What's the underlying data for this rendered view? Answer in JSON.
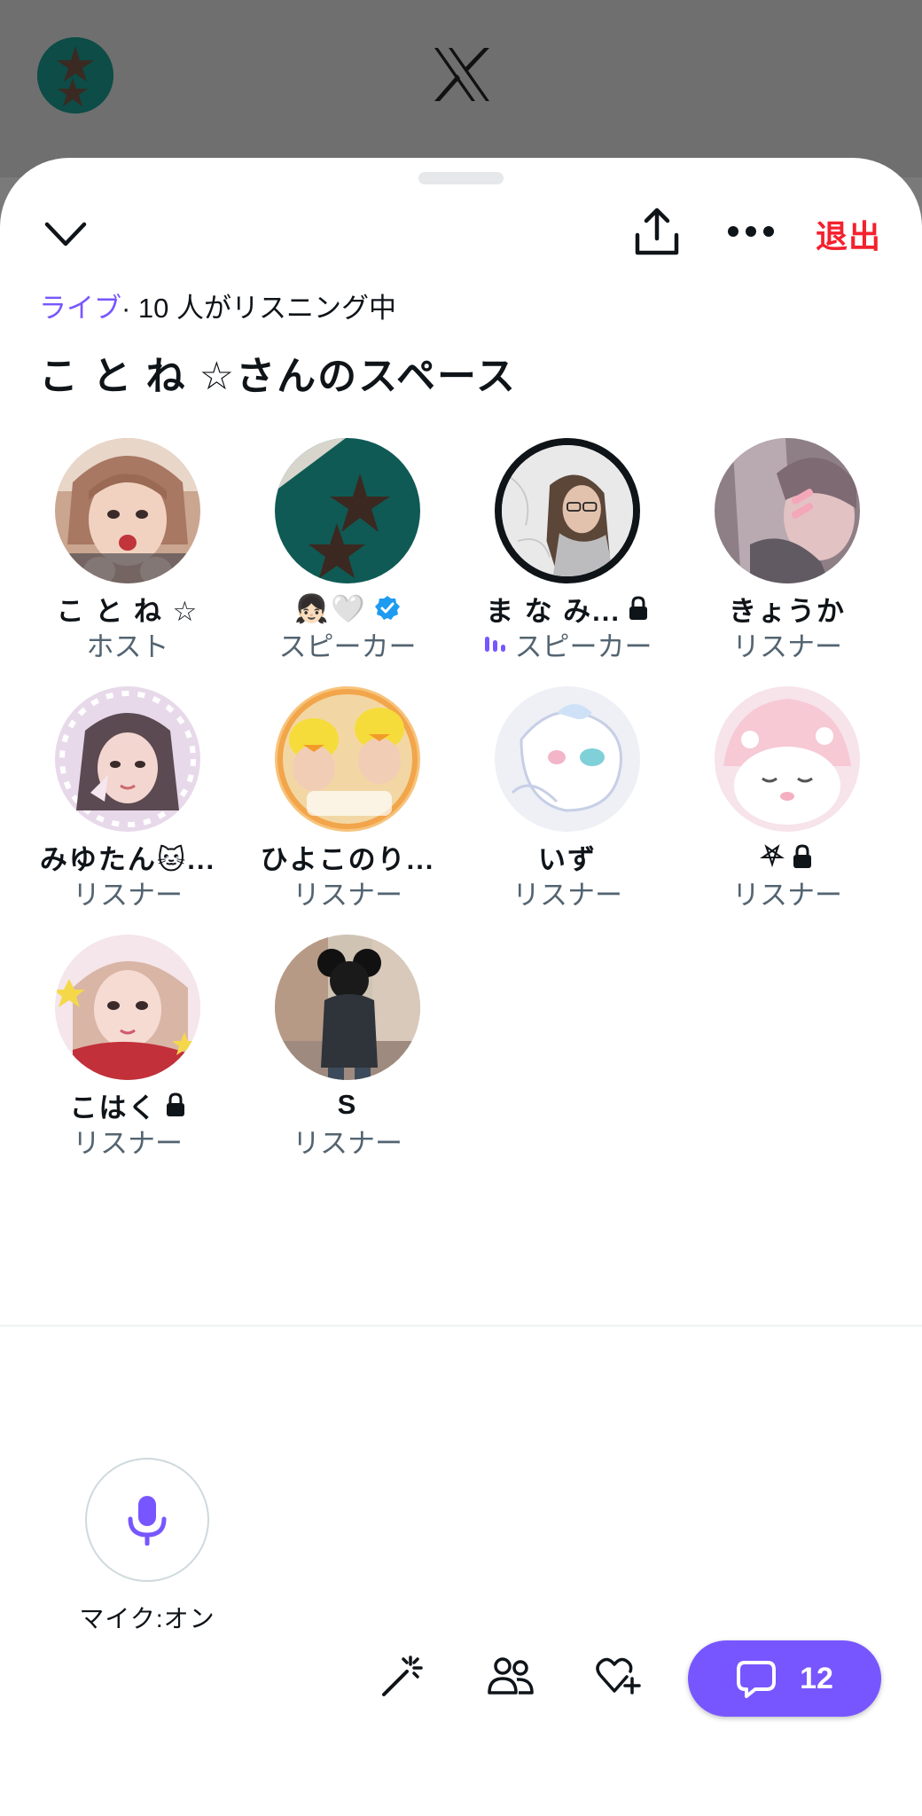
{
  "header": {
    "leave_label": "退出"
  },
  "space": {
    "live_label": "ライブ",
    "listening_text": "· 10 人がリスニング中",
    "title": "こ と ね ☆さんのスペース"
  },
  "participants": [
    {
      "name": "こ と ね ☆",
      "role": "ホスト"
    },
    {
      "name": "👧🏻🤍",
      "role": "スピーカー",
      "verified": true
    },
    {
      "name": "ま な み...",
      "role": "スピーカー",
      "locked": true,
      "speaking": true
    },
    {
      "name": "きょうか",
      "role": "リスナー"
    },
    {
      "name": "みゆたん🐱...",
      "role": "リスナー"
    },
    {
      "name": "ひよこのり...",
      "role": "リスナー"
    },
    {
      "name": "いず",
      "role": "リスナー"
    },
    {
      "name": "⛧",
      "role": "リスナー",
      "locked": true
    },
    {
      "name": "こはく",
      "role": "リスナー",
      "locked": true
    },
    {
      "name": "S",
      "role": "リスナー"
    }
  ],
  "controls": {
    "mic_label": "マイク:オン",
    "comments_count": "12"
  },
  "colors": {
    "accent": "#7856ff",
    "leave": "#f4212e",
    "secondary_text": "#536471"
  },
  "icons": [
    "chevron-down-icon",
    "share-icon",
    "more-icon",
    "microphone-icon",
    "sparkle-wand-icon",
    "people-icon",
    "heart-plus-icon",
    "comment-icon",
    "lock-icon",
    "verified-icon",
    "speaking-icon",
    "x-logo-icon"
  ]
}
